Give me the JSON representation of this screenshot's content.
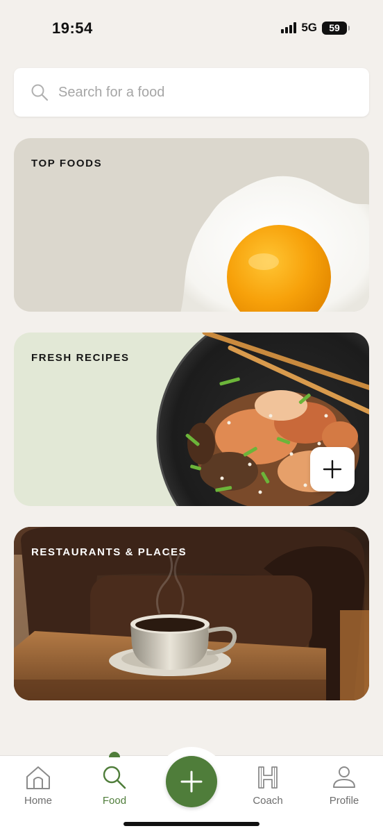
{
  "status": {
    "time": "19:54",
    "network": "5G",
    "battery": "59"
  },
  "search": {
    "placeholder": "Search for a food",
    "icon": "search-icon"
  },
  "cards": [
    {
      "title": "TOP FOODS",
      "image": "fried-egg"
    },
    {
      "title": "FRESH RECIPES",
      "image": "beef-kimchi-stirfry-with-chopsticks"
    },
    {
      "title": "RESTAURANTS & PLACES",
      "image": "coffee-cup-on-table"
    }
  ],
  "nav": {
    "items": [
      {
        "label": "Home",
        "icon": "home-icon"
      },
      {
        "label": "Food",
        "icon": "search-icon",
        "active": true
      },
      {
        "label": "Coach",
        "icon": "coach-icon"
      },
      {
        "label": "Profile",
        "icon": "profile-icon"
      }
    ],
    "fab_icon": "plus-icon"
  },
  "colors": {
    "accent": "#4f7d3a",
    "background": "#f3f0ec",
    "top_foods_card": "#dbd7cd",
    "fresh_recipes_card": "#e2e8d6"
  }
}
